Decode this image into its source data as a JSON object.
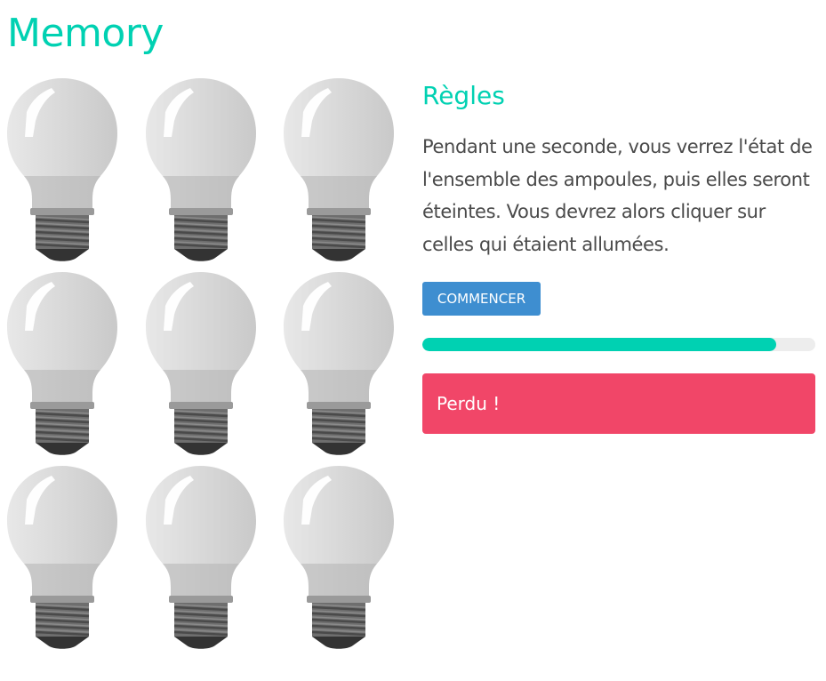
{
  "app": {
    "title": "Memory"
  },
  "rules": {
    "title": "Règles",
    "text": "Pendant une seconde, vous verrez l'état de l'ensemble des ampoules, puis elles seront éteintes. Vous devrez alors cliquer sur celles qui étaient allumées."
  },
  "controls": {
    "start_label": "COMMENCER"
  },
  "progress": {
    "fraction": 0.9
  },
  "notification": {
    "message": "Perdu !"
  },
  "bulbs": {
    "icon": "light-bulb-icon",
    "states": [
      "off",
      "off",
      "off",
      "off",
      "off",
      "off",
      "off",
      "off",
      "off"
    ]
  },
  "colors": {
    "accent": "#00d1b2",
    "button": "#3e8ed0",
    "danger": "#f14668",
    "progress_track": "#ededed",
    "text": "#4a4a4a"
  }
}
